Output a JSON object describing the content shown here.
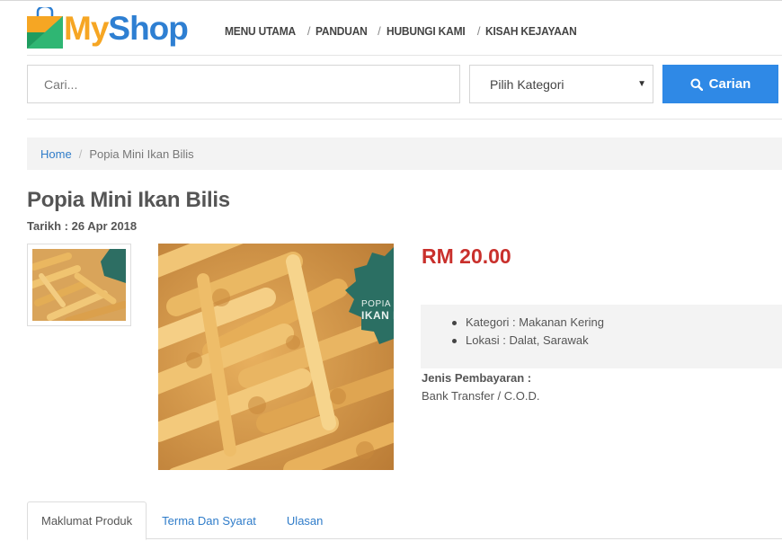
{
  "logo": {
    "my": "My",
    "shop": "Shop"
  },
  "nav": {
    "items": [
      {
        "label": "MENU UTAMA"
      },
      {
        "label": "PANDUAN"
      },
      {
        "label": "HUBUNGI KAMI"
      },
      {
        "label": "KISAH KEJAYAAN"
      }
    ],
    "separator": "/"
  },
  "search": {
    "placeholder": "Cari...",
    "value": "",
    "category_selected": "Pilih Kategori",
    "button_label": "Carian"
  },
  "breadcrumb": {
    "home": "Home",
    "separator": "/",
    "current": "Popia Mini Ikan Bilis"
  },
  "product": {
    "title": "Popia Mini Ikan Bilis",
    "date_label": "Tarikh :",
    "date": "26 Apr 2018",
    "price": "RM 20.00",
    "details": [
      {
        "label": "Kategori :",
        "value": "Makanan Kering"
      },
      {
        "label": "Lokasi :",
        "value": "Dalat, Sarawak"
      }
    ],
    "payment_label": "Jenis Pembayaran :",
    "payment_value": "Bank Transfer / C.O.D.",
    "badge_line1": "POPIA",
    "badge_line2": "IKAN BILIS"
  },
  "tabs": [
    {
      "label": "Maklumat Produk",
      "active": true
    },
    {
      "label": "Terma Dan Syarat",
      "active": false
    },
    {
      "label": "Ulasan",
      "active": false
    }
  ],
  "colors": {
    "accent_blue": "#2f89e6",
    "logo_orange": "#f6a623",
    "logo_blue": "#2e7fd2",
    "price_red": "#c9302c",
    "link_blue": "#2f7cc9"
  },
  "icons": {
    "logo": "shopping-bag-logo-icon",
    "search": "search-icon",
    "dropdown": "caret-down-icon"
  }
}
